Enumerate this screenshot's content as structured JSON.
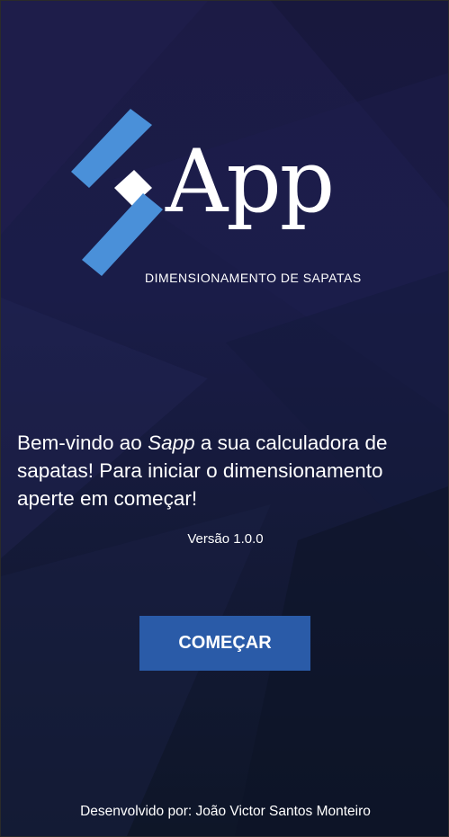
{
  "colors": {
    "background_top": "#1c1b45",
    "background_bottom": "#0e1628",
    "logo_blue": "#4a90d9",
    "button_blue": "#2a5ba8",
    "text": "#ffffff"
  },
  "logo": {
    "icon": "sapp-logo-icon",
    "wordmark": "App",
    "subtitle": "DIMENSIONAMENTO DE SAPATAS"
  },
  "welcome": {
    "prefix": "Bem-vindo ao ",
    "app_name": "Sapp",
    "suffix": " a sua calculadora de sapatas! Para iniciar o dimensionamento aperte em começar!"
  },
  "version": "Versão 1.0.0",
  "start_button": {
    "label": "COMEÇAR"
  },
  "developer": "Desenvolvido por: João Victor Santos Monteiro"
}
